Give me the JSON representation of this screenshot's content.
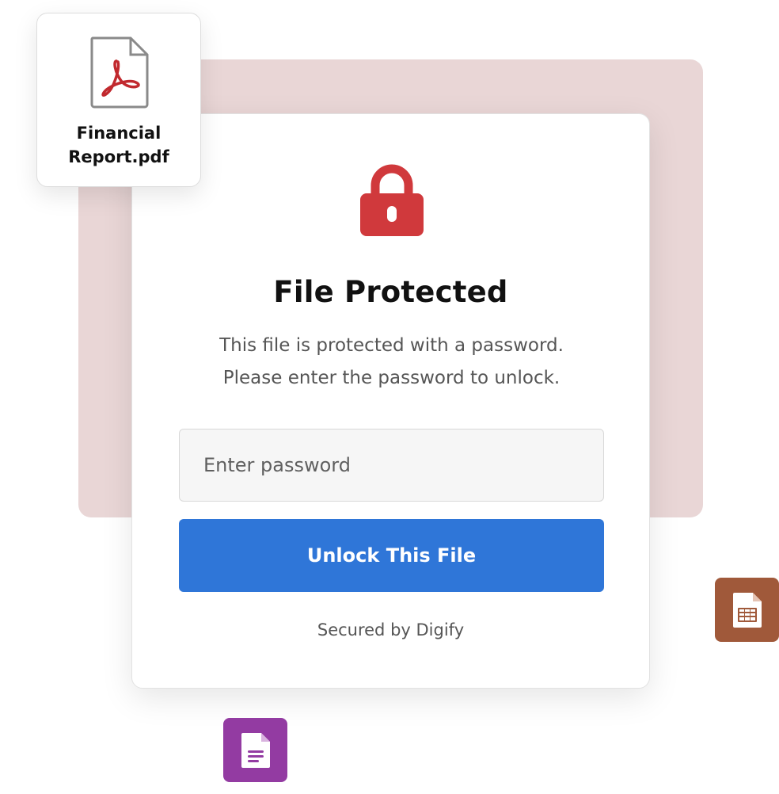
{
  "file_card": {
    "icon": "pdf-file-icon",
    "name": "Financial\nReport.pdf"
  },
  "dialog": {
    "icon": "lock-icon",
    "title": "File Protected",
    "description": "This  file is protected with a password.\nPlease enter the password to unlock.",
    "password_placeholder": "Enter password",
    "password_value": "",
    "unlock_label": "Unlock This File",
    "footer": "Secured by Digify"
  },
  "floating_icons": [
    {
      "icon": "spreadsheet-icon",
      "color": "#a0593a"
    },
    {
      "icon": "document-icon",
      "color": "#933ba2"
    }
  ],
  "colors": {
    "accent": "#2f76d8",
    "lock": "#d0393c",
    "backdrop": "#e9d6d6"
  }
}
